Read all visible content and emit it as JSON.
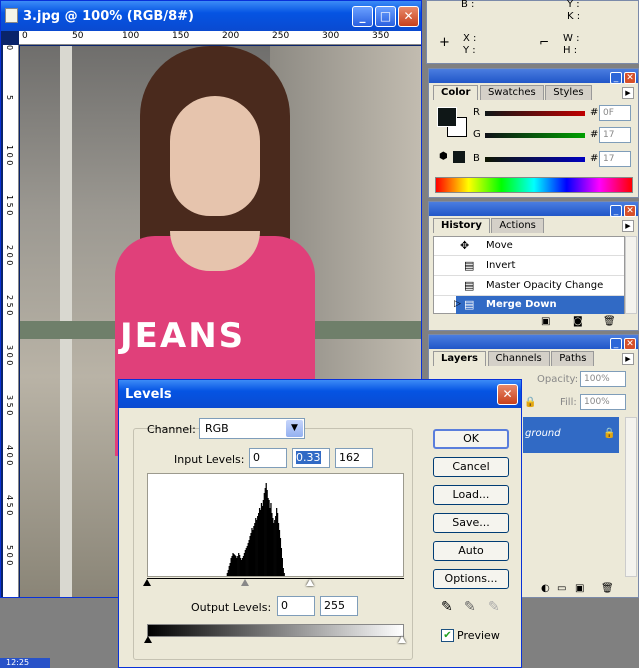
{
  "info_panel": {
    "row1": {
      "l1": "B :",
      "l2": "Y :",
      "l3": "K :"
    },
    "xy": {
      "x": "X :",
      "y": "Y :"
    },
    "wh": {
      "w": "W :",
      "h": "H :"
    }
  },
  "image_window": {
    "title": "3.jpg @ 100% (RGB/8#)",
    "ruler_h": [
      "0",
      "50",
      "100",
      "150",
      "200",
      "250",
      "300",
      "350"
    ],
    "ruler_v": [
      "0",
      "5",
      "1 0 0",
      "1 5 0",
      "2 0 0",
      "2 5 0",
      "3 0 0",
      "3 5 0",
      "4 0 0",
      "4 5 0",
      "5 0 0"
    ],
    "photo_text": "JEANS"
  },
  "color_panel": {
    "tabs": [
      "Color",
      "Swatches",
      "Styles"
    ],
    "channels": [
      {
        "label": "R",
        "value": "0F",
        "color": "#c00000"
      },
      {
        "label": "G",
        "value": "17",
        "color": "#00a000"
      },
      {
        "label": "B",
        "value": "17",
        "color": "#0000c0"
      }
    ],
    "hash": "#"
  },
  "history_panel": {
    "tabs": [
      "History",
      "Actions"
    ],
    "items": [
      "Move",
      "Invert",
      "Master Opacity Change",
      "Merge Down"
    ],
    "selected": "Merge Down"
  },
  "layers_panel": {
    "tabs": [
      "Layers",
      "Channels",
      "Paths"
    ],
    "opacity_label": "Opacity:",
    "opacity_value": "100%",
    "fill_label": "Fill:",
    "fill_value": "100%",
    "layer_name": "ground"
  },
  "levels": {
    "title": "Levels",
    "channel_label": "Channel:",
    "channel_value": "RGB",
    "input_label": "Input Levels:",
    "input_values": [
      "0",
      "0.33",
      "162"
    ],
    "output_label": "Output Levels:",
    "output_values": [
      "0",
      "255"
    ],
    "buttons": {
      "ok": "OK",
      "cancel": "Cancel",
      "load": "Load...",
      "save": "Save...",
      "auto": "Auto",
      "options": "Options..."
    },
    "preview_label": "Preview",
    "preview_checked": true,
    "histogram": [
      0,
      0,
      0,
      0,
      0,
      0,
      0,
      0,
      0,
      0,
      0,
      0,
      0,
      0,
      0,
      0,
      0,
      0,
      0,
      0,
      0,
      0,
      0,
      0,
      0,
      0,
      0,
      0,
      0,
      0,
      0,
      0,
      0,
      0,
      0,
      0,
      0,
      0,
      0,
      0,
      0,
      0,
      0,
      0,
      0,
      0,
      0,
      0,
      0,
      0,
      0,
      0,
      0,
      0,
      0,
      0,
      0,
      0,
      0,
      0,
      0,
      0,
      0,
      0,
      0,
      0,
      0,
      0,
      0,
      0,
      0,
      0,
      0,
      0,
      0,
      0,
      0,
      0,
      0,
      0,
      0,
      0,
      0.02,
      0.05,
      0.08,
      0.12,
      0.15,
      0.2,
      0.22,
      0.25,
      0.24,
      0.23,
      0.22,
      0.2,
      0.22,
      0.25,
      0.23,
      0.2,
      0.18,
      0.2,
      0.22,
      0.25,
      0.28,
      0.3,
      0.32,
      0.35,
      0.38,
      0.42,
      0.45,
      0.5,
      0.48,
      0.52,
      0.55,
      0.6,
      0.58,
      0.62,
      0.65,
      0.7,
      0.68,
      0.75,
      0.72,
      0.78,
      0.85,
      0.9,
      0.95,
      0.88,
      0.8,
      0.78,
      0.7,
      0.75,
      0.65,
      0.6,
      0.55,
      0.58,
      0.62,
      0.7,
      0.65,
      0.55,
      0.48,
      0.4,
      0.3,
      0.2,
      0.1,
      0.05,
      0.02,
      0,
      0,
      0,
      0,
      0,
      0,
      0,
      0,
      0,
      0,
      0,
      0,
      0,
      0,
      0,
      0,
      0,
      0,
      0,
      0,
      0,
      0,
      0,
      0,
      0,
      0,
      0,
      0,
      0,
      0,
      0,
      0,
      0,
      0,
      0,
      0,
      0,
      0,
      0,
      0,
      0,
      0,
      0,
      0,
      0,
      0,
      0,
      0,
      0,
      0,
      0,
      0,
      0,
      0,
      0,
      0,
      0,
      0,
      0,
      0,
      0,
      0,
      0,
      0,
      0,
      0,
      0,
      0,
      0,
      0,
      0,
      0,
      0,
      0,
      0,
      0,
      0,
      0,
      0,
      0,
      0,
      0,
      0,
      0,
      0,
      0,
      0,
      0,
      0,
      0,
      0,
      0,
      0,
      0,
      0,
      0,
      0,
      0,
      0,
      0,
      0,
      0,
      0,
      0,
      0,
      0,
      0,
      0,
      0,
      0,
      0,
      0,
      0,
      0,
      0,
      0,
      0,
      0,
      0,
      0,
      0,
      0,
      0,
      0,
      0,
      0
    ],
    "input_sliders": [
      0,
      0.33,
      162
    ]
  },
  "taskbar": {
    "clock": "12:25"
  }
}
